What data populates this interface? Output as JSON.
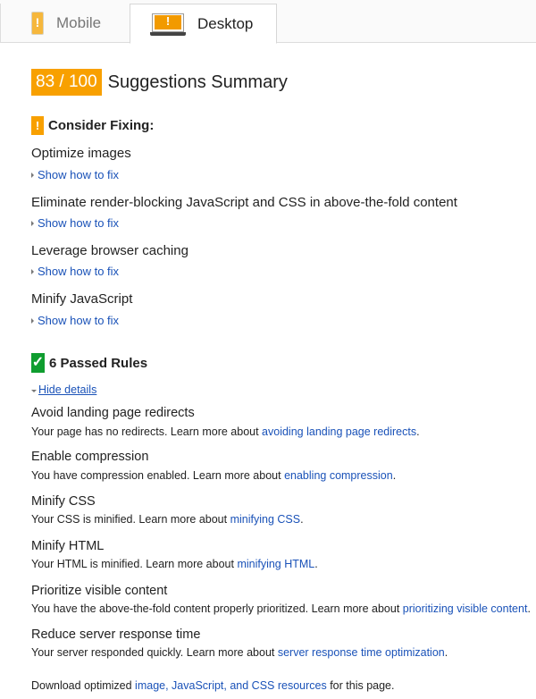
{
  "tabs": [
    {
      "label": "Mobile",
      "icon": "mobile-phone-warning-icon",
      "active": false
    },
    {
      "label": "Desktop",
      "icon": "laptop-warning-icon",
      "active": true
    }
  ],
  "summary": {
    "score": "83 / 100",
    "title": "Suggestions Summary"
  },
  "colors": {
    "warning": "#f8a000",
    "passed": "#0f9d2f",
    "link": "#1a52b8"
  },
  "consider_fixing": {
    "icon_glyph": "!",
    "heading": "Consider Fixing:",
    "items": [
      {
        "title": "Optimize images",
        "link": "Show how to fix"
      },
      {
        "title": "Eliminate render-blocking JavaScript and CSS in above-the-fold content",
        "link": "Show how to fix"
      },
      {
        "title": "Leverage browser caching",
        "link": "Show how to fix"
      },
      {
        "title": "Minify JavaScript",
        "link": "Show how to fix"
      }
    ]
  },
  "passed": {
    "icon_glyph": "✓",
    "heading": "6 Passed Rules",
    "toggle": "Hide details",
    "items": [
      {
        "title": "Avoid landing page redirects",
        "desc": "Your page has no redirects. Learn more about ",
        "link": "avoiding landing page redirects",
        "suffix": "."
      },
      {
        "title": "Enable compression",
        "desc": "You have compression enabled. Learn more about ",
        "link": "enabling compression",
        "suffix": "."
      },
      {
        "title": "Minify CSS",
        "desc": "Your CSS is minified. Learn more about ",
        "link": "minifying CSS",
        "suffix": "."
      },
      {
        "title": "Minify HTML",
        "desc": "Your HTML is minified. Learn more about ",
        "link": "minifying HTML",
        "suffix": "."
      },
      {
        "title": "Prioritize visible content",
        "desc": "You have the above-the-fold content properly prioritized. Learn more about ",
        "link": "prioritizing visible content",
        "suffix": "."
      },
      {
        "title": "Reduce server response time",
        "desc": "Your server responded quickly. Learn more about ",
        "link": "server response time optimization",
        "suffix": "."
      }
    ]
  },
  "footer": {
    "prefix": "Download optimized ",
    "link": "image, JavaScript, and CSS resources",
    "suffix": " for this page."
  }
}
